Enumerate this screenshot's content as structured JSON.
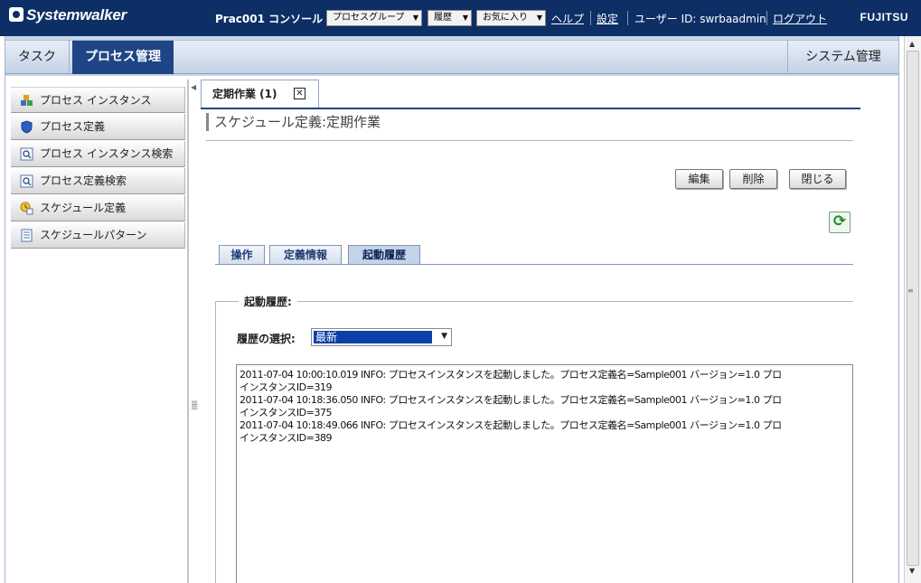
{
  "topbar": {
    "logo": "Systemwalker",
    "console_name": "Prac001 コンソール",
    "dropdowns": [
      "プロセスグループ",
      "履歴",
      "お気に入り"
    ],
    "links": [
      "ヘルプ",
      "設定"
    ],
    "user_label": "ユーザー ID: swrbaadmin",
    "logout": "ログアウト",
    "vendor": "FUJITSU"
  },
  "nav": {
    "tabs": [
      "タスク",
      "プロセス管理"
    ],
    "active_tab": "プロセス管理",
    "right_tab": "システム管理"
  },
  "sidebar": {
    "items": [
      {
        "label": "プロセス インスタンス",
        "icon": "process-instance-icon"
      },
      {
        "label": "プロセス定義",
        "icon": "process-definition-icon"
      },
      {
        "label": "プロセス インスタンス検索",
        "icon": "instance-search-icon"
      },
      {
        "label": "プロセス定義検索",
        "icon": "definition-search-icon"
      },
      {
        "label": "スケジュール定義",
        "icon": "schedule-definition-icon"
      },
      {
        "label": "スケジュールパターン",
        "icon": "schedule-pattern-icon"
      }
    ]
  },
  "main": {
    "doc_tab": "定期作業 (1)",
    "title": "スケジュール定義:定期作業",
    "buttons": {
      "edit": "編集",
      "delete": "削除",
      "close": "閉じる"
    },
    "subtabs": [
      "操作",
      "定義情報",
      "起動履歴"
    ],
    "active_subtab": "起動履歴",
    "legend": "起動履歴:",
    "history_label": "履歴の選択:",
    "history_selected": "最新",
    "log_lines": [
      "2011-07-04 10:00:10.019 INFO: プロセスインスタンスを起動しました。プロセス定義名=Sample001 バージョン=1.0 プロ",
      "インスタンスID=319",
      "2011-07-04 10:18:36.050 INFO: プロセスインスタンスを起動しました。プロセス定義名=Sample001 バージョン=1.0 プロ",
      "インスタンスID=375",
      "2011-07-04 10:18:49.066 INFO: プロセスインスタンスを起動しました。プロセス定義名=Sample001 バージョン=1.0 プロ",
      "インスタンスID=389"
    ]
  },
  "colors": {
    "header_bg": "#0d2f66",
    "active_tab_bg": "#1e4585",
    "selection_bg": "#0c3fa8"
  }
}
